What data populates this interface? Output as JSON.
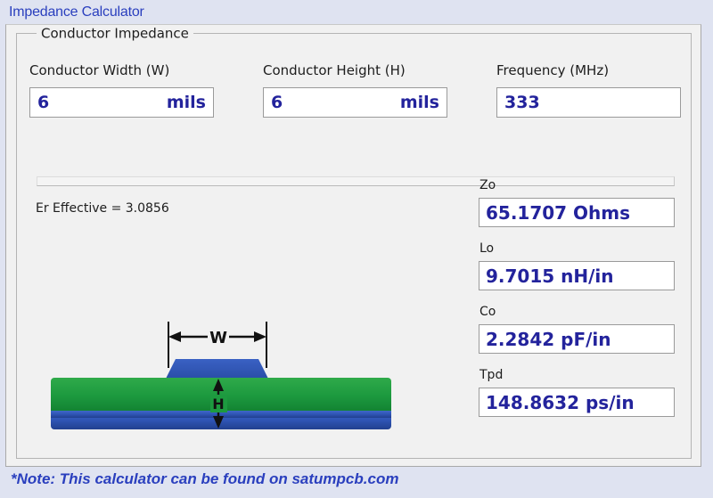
{
  "window": {
    "title": "Impedance Calculator"
  },
  "group": {
    "legend": "Conductor Impedance"
  },
  "inputs": [
    {
      "label": "Conductor Width (W)",
      "value": "6",
      "unit": "mils",
      "name": "conductor-width"
    },
    {
      "label": "Conductor Height (H)",
      "value": "6",
      "unit": "mils",
      "name": "conductor-height"
    },
    {
      "label": "Frequency (MHz)",
      "value": "333",
      "unit": "",
      "name": "frequency"
    }
  ],
  "er": {
    "text": "Er Effective = 3.0856"
  },
  "results": [
    {
      "label": "Zo",
      "value": "65.1707 Ohms"
    },
    {
      "label": "Lo",
      "value": "9.7015 nH/in"
    },
    {
      "label": "Co",
      "value": "2.2842 pF/in"
    },
    {
      "label": "Tpd",
      "value": "148.8632 ps/in"
    }
  ],
  "diagram": {
    "width_label": "W",
    "height_label": "H",
    "trace_color": "#2f55b5",
    "dielectric_color": "#1d9a3f",
    "ground_color": "#2f55b5"
  },
  "footer": {
    "note": "*Note: This calculator can be found on satumpcb.com"
  },
  "colors": {
    "window_background": "#dfe3f1",
    "panel_background": "#f1f1f1",
    "title_text": "#2a3fbe",
    "value_text": "#23239c"
  }
}
